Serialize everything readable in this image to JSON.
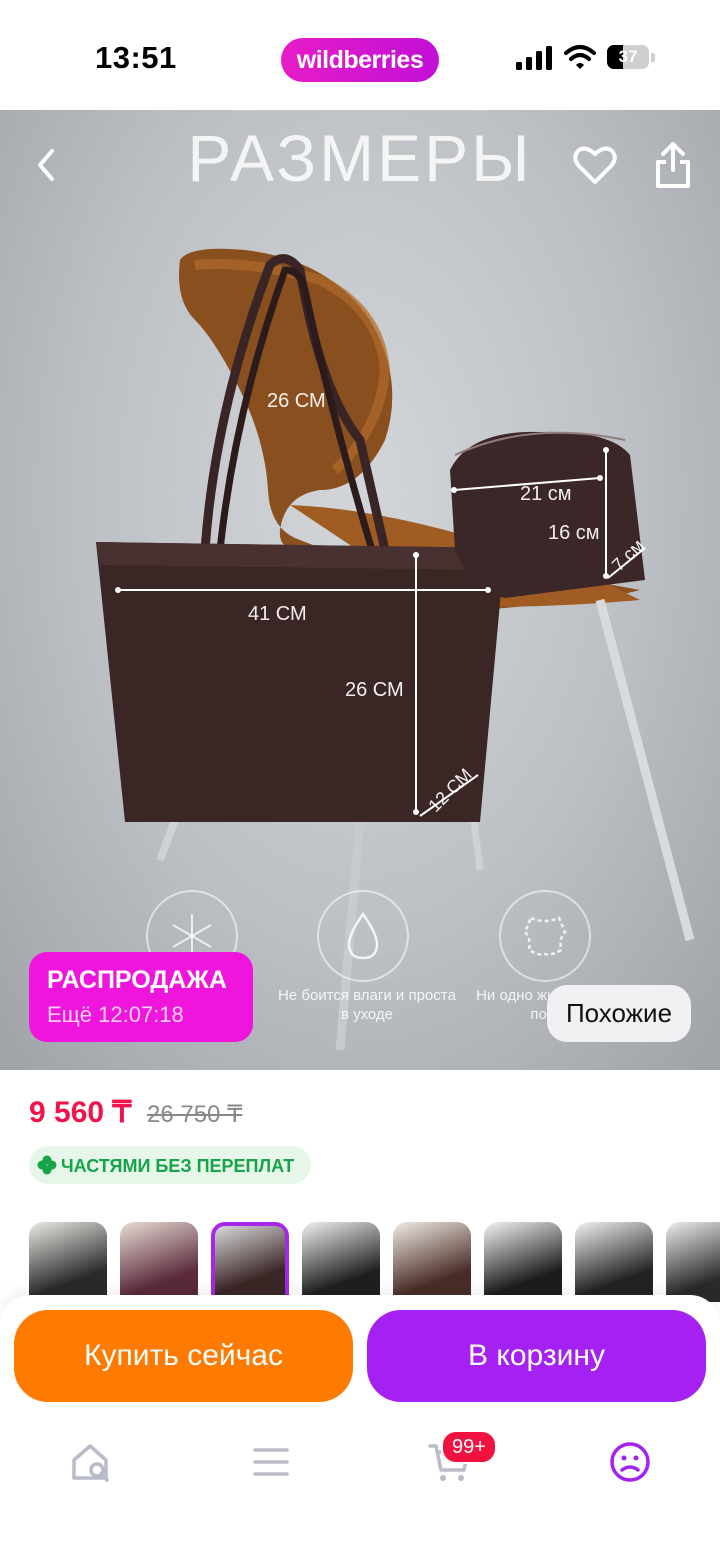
{
  "status_bar": {
    "time": "13:51",
    "battery": "37",
    "battery_level": 0.37
  },
  "app": {
    "logo": "wildberries",
    "brand_color": "#cb11ab"
  },
  "hero": {
    "title": "РАЗМЕРЫ",
    "dimensions": [
      "26 СМ",
      "41 СМ",
      "26 СМ",
      "12 СМ",
      "21 см",
      "16 см",
      "7 см"
    ],
    "features": [
      {
        "icon": "snowflake-icon",
        "text": ""
      },
      {
        "icon": "water-drop-icon",
        "text": "Не боится влаги и простa в уходе"
      },
      {
        "icon": "leather-icon",
        "text": "Ни одно животное не постр"
      }
    ],
    "sale": {
      "title": "РАСПРОДАЖА",
      "timer": "Ещё 12:07:18"
    },
    "similar_button": "Похожие"
  },
  "product": {
    "price": "9 560 ₸",
    "old_price": "26 750 ₸",
    "installment": "ЧАСТЯМИ БЕЗ ПЕРЕПЛАТ",
    "thumbnails_count": 8,
    "active_thumbnail": 3
  },
  "actions": {
    "buy_now": "Купить сейчас",
    "add_to_cart": "В корзину"
  },
  "tab_bar": {
    "items": [
      "home-search-icon",
      "menu-icon",
      "cart-icon",
      "profile-icon"
    ],
    "cart_badge": "99+"
  },
  "colors": {
    "price": "#f2134a",
    "buy_now": "#ff7a00",
    "add_cart": "#a521f2",
    "sale": "#f015dd",
    "installment": "#17a34a"
  }
}
